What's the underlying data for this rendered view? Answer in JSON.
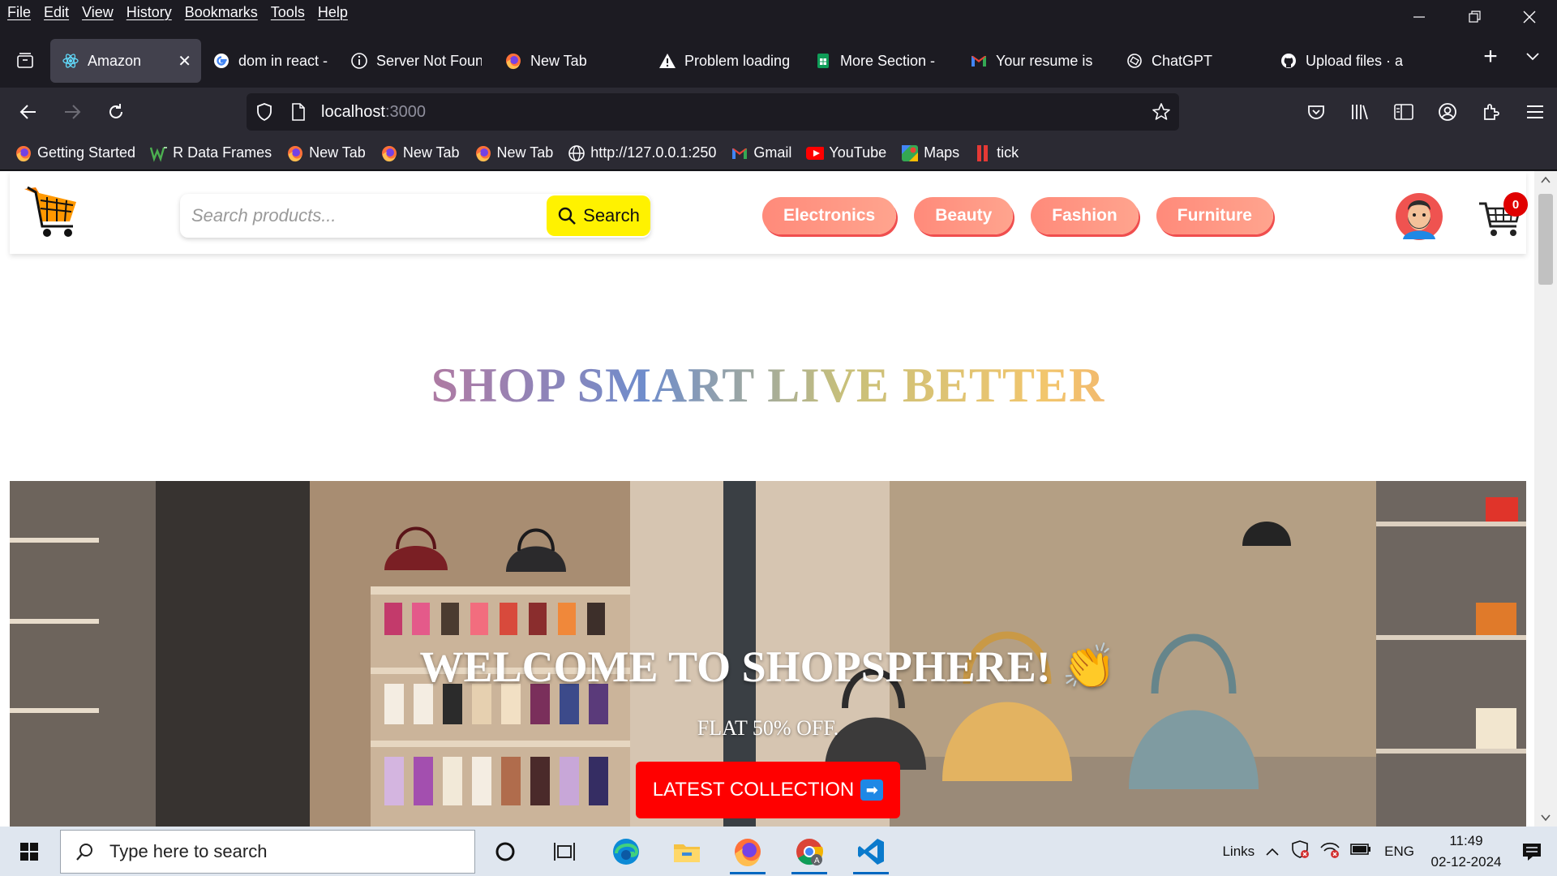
{
  "menu": [
    "File",
    "Edit",
    "View",
    "History",
    "Bookmarks",
    "Tools",
    "Help"
  ],
  "tabs": [
    {
      "label": "Amazon",
      "icon": "react-icon",
      "active": true
    },
    {
      "label": "dom in react - G",
      "icon": "google-icon"
    },
    {
      "label": "Server Not Foun",
      "icon": "info-icon"
    },
    {
      "label": "New Tab",
      "icon": "firefox-icon"
    },
    {
      "label": "Problem loading",
      "icon": "warning-icon"
    },
    {
      "label": "More Section -",
      "icon": "sheets-icon"
    },
    {
      "label": "Your resume is",
      "icon": "gmail-icon"
    },
    {
      "label": "ChatGPT",
      "icon": "chatgpt-icon"
    },
    {
      "label": "Upload files · ar",
      "icon": "github-icon"
    }
  ],
  "url": {
    "host": "localhost",
    "port": ":3000"
  },
  "bookmarks": [
    {
      "label": "Getting Started",
      "icon": "firefox-icon"
    },
    {
      "label": "R Data Frames",
      "icon": "w-icon"
    },
    {
      "label": "New Tab",
      "icon": "firefox-icon"
    },
    {
      "label": "New Tab",
      "icon": "firefox-icon"
    },
    {
      "label": "New Tab",
      "icon": "firefox-icon"
    },
    {
      "label": "http://127.0.0.1:250",
      "icon": "globe-icon"
    },
    {
      "label": "Gmail",
      "icon": "gmail-icon"
    },
    {
      "label": "YouTube",
      "icon": "youtube-icon"
    },
    {
      "label": "Maps",
      "icon": "maps-icon"
    },
    {
      "label": "tick",
      "icon": "tick-icon"
    }
  ],
  "site": {
    "search_placeholder": "Search products...",
    "search_button": "Search",
    "categories": [
      "Electronics",
      "Beauty",
      "Fashion",
      "Furniture"
    ],
    "cart_count": "0",
    "tagline_words": [
      "SHOP",
      "SMART",
      "LIVE",
      "BETTER"
    ],
    "hero_title": "WELCOME TO SHOPSPHERE! 👏",
    "hero_sub": "FLAT 50% OFF.",
    "hero_button": "LATEST COLLECTION"
  },
  "taskbar": {
    "search_placeholder": "Type here to search",
    "tray_links": "Links",
    "lang": "ENG",
    "time": "11:49",
    "date": "02-12-2024"
  },
  "colors": {
    "accent_cat": "#ff8a7a",
    "search_btn": "#fff200",
    "hero_btn": "#ff0000",
    "badge": "#e00000"
  }
}
